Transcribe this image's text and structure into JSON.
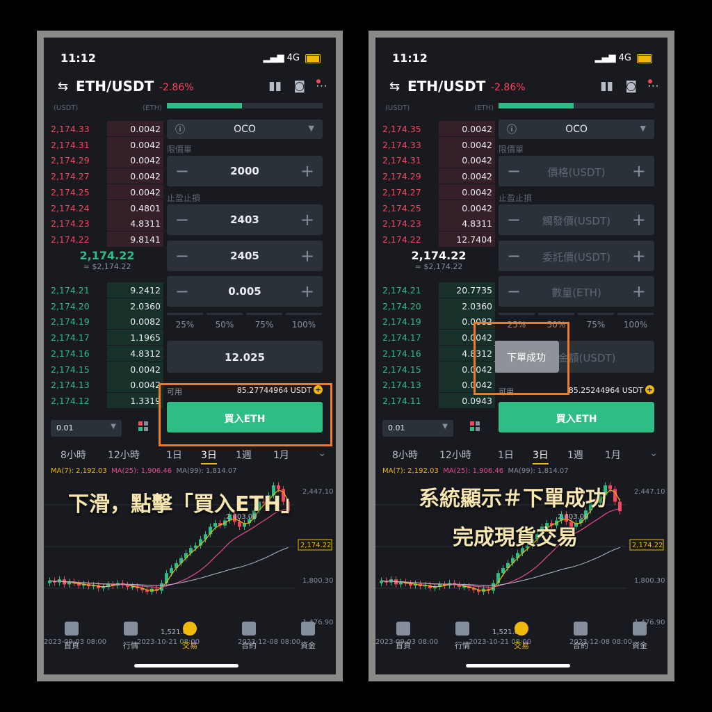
{
  "status": {
    "time": "11:12",
    "network": "4G"
  },
  "header": {
    "pair": "ETH/USDT",
    "change": "-2.86%"
  },
  "orderbook_head": {
    "left": "(USDT)",
    "right": "(ETH)"
  },
  "left": {
    "asks": [
      {
        "p": "2,174.33",
        "q": "0.0042",
        "d": 0.5
      },
      {
        "p": "2,174.31",
        "q": "0.0042",
        "d": 0.5
      },
      {
        "p": "2,174.29",
        "q": "0.0042",
        "d": 0.5
      },
      {
        "p": "2,174.27",
        "q": "0.0042",
        "d": 0.5
      },
      {
        "p": "2,174.25",
        "q": "0.0042",
        "d": 0.5
      },
      {
        "p": "2,174.24",
        "q": "0.4801",
        "d": 0.5
      },
      {
        "p": "2,174.23",
        "q": "4.8311",
        "d": 0.5
      },
      {
        "p": "2,174.22",
        "q": "9.8141",
        "d": 0.5
      }
    ],
    "last_price": "2,174.22",
    "last_fiat": "≈ $2,174.22",
    "bids": [
      {
        "p": "2,174.21",
        "q": "9.2412",
        "d": 0.5
      },
      {
        "p": "2,174.20",
        "q": "2.0360",
        "d": 0.5
      },
      {
        "p": "2,174.19",
        "q": "0.0082",
        "d": 0.5
      },
      {
        "p": "2,174.17",
        "q": "1.1965",
        "d": 0.5
      },
      {
        "p": "2,174.16",
        "q": "4.8312",
        "d": 0.5
      },
      {
        "p": "2,174.15",
        "q": "0.0042",
        "d": 0.5
      },
      {
        "p": "2,174.13",
        "q": "0.0042",
        "d": 0.5
      },
      {
        "p": "2,174.12",
        "q": "1.3319",
        "d": 0.5
      }
    ],
    "fields": {
      "price": "2000",
      "trigger": "2403",
      "limit": "2405",
      "amount": "0.005",
      "total": "12.025"
    },
    "available": "85.27744964 USDT",
    "caption": "下滑，點擊「買入ETH」"
  },
  "right": {
    "asks": [
      {
        "p": "2,174.35",
        "q": "0.0042",
        "d": 0.5
      },
      {
        "p": "2,174.33",
        "q": "0.0042",
        "d": 0.5
      },
      {
        "p": "2,174.31",
        "q": "0.0042",
        "d": 0.5
      },
      {
        "p": "2,174.29",
        "q": "0.0042",
        "d": 0.5
      },
      {
        "p": "2,174.27",
        "q": "0.0042",
        "d": 0.5
      },
      {
        "p": "2,174.25",
        "q": "0.0042",
        "d": 0.5
      },
      {
        "p": "2,174.23",
        "q": "4.8311",
        "d": 0.5
      },
      {
        "p": "2,174.22",
        "q": "12.7404",
        "d": 0.5
      }
    ],
    "last_price": "2,174.22",
    "last_fiat": "≈ $2,174.22",
    "bids": [
      {
        "p": "2,174.21",
        "q": "20.7735",
        "d": 0.5
      },
      {
        "p": "2,174.20",
        "q": "2.0360",
        "d": 0.5
      },
      {
        "p": "2,174.19",
        "q": "0.0082",
        "d": 0.5
      },
      {
        "p": "2,174.17",
        "q": "0.0042",
        "d": 0.5
      },
      {
        "p": "2,174.16",
        "q": "4.8312",
        "d": 0.5
      },
      {
        "p": "2,174.15",
        "q": "0.0042",
        "d": 0.5
      },
      {
        "p": "2,174.13",
        "q": "0.0042",
        "d": 0.5
      },
      {
        "p": "2,174.11",
        "q": "0.0943",
        "d": 0.5
      }
    ],
    "placeholders": {
      "price": "價格(USDT)",
      "trigger": "觸發價(USDT)",
      "limit": "委託價(USDT)",
      "amount": "數量(ETH)",
      "total": "交易金額(USDT)"
    },
    "available": "85.25244964 USDT",
    "toast": "下單成功",
    "caption1": "系統顯示＃下單成功",
    "caption2": "完成現貨交易"
  },
  "form": {
    "order_type": "OCO",
    "limit_label": "限價單",
    "tpsl_label": "止盈止損",
    "pcts": [
      "25%",
      "50%",
      "75%",
      "100%"
    ],
    "available_label": "可用",
    "buy_label": "買入ETH"
  },
  "decimal": "0.01",
  "timeframes": [
    "8小時",
    "12小時",
    "1日",
    "3日",
    "1週",
    "1月"
  ],
  "ma": {
    "ma7": "MA(7): 2,192.03",
    "ma25": "MA(25): 1,906.46",
    "ma99": "MA(99): 1,814.07"
  },
  "chart_axis": {
    "high": "2,447.10",
    "price": "2,174.22",
    "mid": "1,800.30",
    "low": "1,476.90",
    "max_label": "2,403.00",
    "min_label": "1,521.00",
    "dates": [
      "2023-09-03 08:00",
      "2023-10-21 08:00",
      "2023-12-08 08:00"
    ]
  },
  "nav": [
    "首頁",
    "行情",
    "交易",
    "合約",
    "資金"
  ],
  "colors": {
    "ask": "#f6465d",
    "bid": "#2ebd85",
    "accent": "#f0b90b",
    "highlight": "#f47a20"
  }
}
